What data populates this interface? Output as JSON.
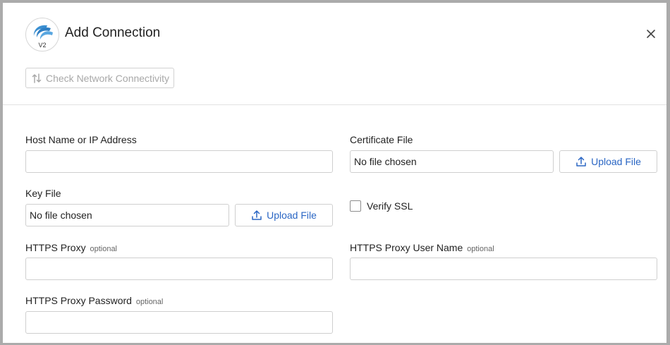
{
  "dialog": {
    "title": "Add Connection",
    "logo_version": "V2",
    "check_button_label": "Check Network Connectivity",
    "colors": {
      "accent": "#2a66c4",
      "logo": "#3a8fd1"
    }
  },
  "form": {
    "host": {
      "label": "Host Name or IP Address",
      "value": ""
    },
    "certificate": {
      "label": "Certificate File",
      "value": "No file chosen",
      "upload_label": "Upload File"
    },
    "key": {
      "label": "Key File",
      "value": "No file chosen",
      "upload_label": "Upload File"
    },
    "verify_ssl": {
      "label": "Verify SSL",
      "checked": false
    },
    "https_proxy": {
      "label": "HTTPS Proxy",
      "optional": "optional",
      "value": ""
    },
    "https_proxy_user": {
      "label": "HTTPS Proxy User Name",
      "optional": "optional",
      "value": ""
    },
    "https_proxy_password": {
      "label": "HTTPS Proxy Password",
      "optional": "optional",
      "value": ""
    }
  }
}
